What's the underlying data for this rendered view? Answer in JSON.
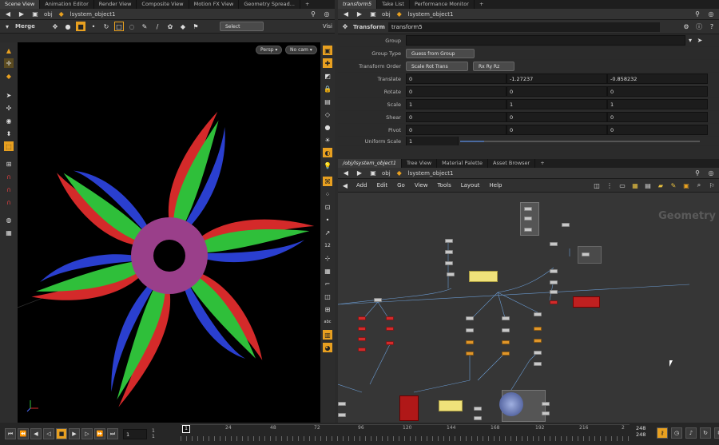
{
  "left_tabs": [
    "Scene View",
    "Animation Editor",
    "Render View",
    "Composite View",
    "Motion FX View",
    "Geometry Spread..."
  ],
  "left_path": {
    "network": "obj",
    "node": "lsystem_object1"
  },
  "viewer_toolbar": {
    "node_label": "Merge",
    "select_label": "Select",
    "visibility_label": "Visi"
  },
  "viewport": {
    "persp_label": "Persp ▾",
    "cam_label": "No cam ▾"
  },
  "right_top_tabs": [
    "transform5",
    "Take List",
    "Performance Monitor"
  ],
  "right_top_path": {
    "network": "obj",
    "node": "lsystem_object1"
  },
  "parm_panel": {
    "node_type": "Transform",
    "node_name": "transform5",
    "group_label": "Group",
    "group_value": "",
    "group_type_label": "Group Type",
    "group_type_value": "Guess from Group",
    "transform_order_label": "Transform Order",
    "transform_order_value": "Scale Rot Trans",
    "rot_order_value": "Rx Ry Rz",
    "rows": [
      {
        "label": "Translate",
        "v": [
          "0",
          "-1.27237",
          "-0.858232"
        ]
      },
      {
        "label": "Rotate",
        "v": [
          "0",
          "0",
          "0"
        ]
      },
      {
        "label": "Scale",
        "v": [
          "1",
          "1",
          "1"
        ]
      },
      {
        "label": "Shear",
        "v": [
          "0",
          "0",
          "0"
        ]
      },
      {
        "label": "Pivot",
        "v": [
          "0",
          "0",
          "0"
        ]
      }
    ],
    "uniform_label": "Uniform Scale",
    "uniform_value": "1"
  },
  "net_tabs": [
    "/obj/lsystem_object1",
    "Tree View",
    "Material Palette",
    "Asset Browser"
  ],
  "net_path": {
    "network": "obj",
    "node": "lsystem_object1"
  },
  "net_menu": [
    "Add",
    "Edit",
    "Go",
    "View",
    "Tools",
    "Layout",
    "Help"
  ],
  "net_context_label": "Geometry",
  "timeline": {
    "current_frame": "1",
    "start": "1",
    "start2": "1",
    "end": "248",
    "end2": "248",
    "ticks": [
      "1",
      "24",
      "48",
      "72",
      "96",
      "120",
      "144",
      "168",
      "192",
      "216",
      "2"
    ]
  },
  "colors": {
    "accent": "#e8a020",
    "red": "#d42a2a",
    "blue": "#2a3fcf",
    "green": "#2fbf3a",
    "purple": "#9a3f8a"
  }
}
